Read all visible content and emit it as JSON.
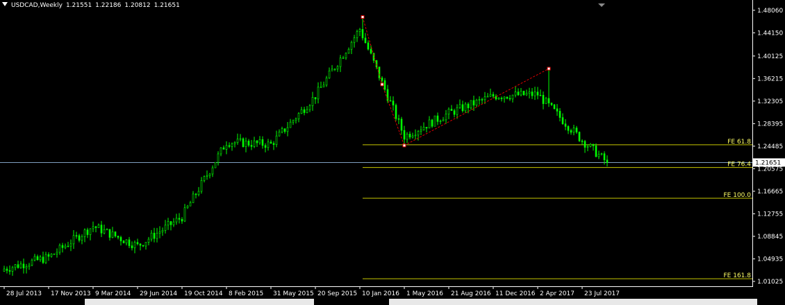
{
  "header": {
    "symbol": "USDCAD,Weekly",
    "open": "1.21551",
    "high": "1.22186",
    "low": "1.20812",
    "close": "1.21651"
  },
  "colors": {
    "background": "#000000",
    "candle": "#00ff00",
    "axis_text": "#ffffff",
    "fibo_line": "#c8c800",
    "fibo_text": "#ffff66",
    "pattern_line": "#dd0000",
    "price_line": "#7f9fc0",
    "price_label_bg": "#ffffff"
  },
  "chart_data": {
    "type": "candlestick",
    "symbol": "USDCAD",
    "timeframe": "Weekly",
    "ylim": [
      1.003,
      1.49
    ],
    "y_ticks": [
      "1.48060",
      "1.44150",
      "1.40125",
      "1.36215",
      "1.32305",
      "1.28395",
      "1.24485",
      "1.20575",
      "1.16665",
      "1.12755",
      "1.08845",
      "1.04935",
      "1.01025"
    ],
    "x_ticks": [
      "28 Jul 2013",
      "17 Nov 2013",
      "9 Mar 2014",
      "29 Jun 2014",
      "19 Oct 2014",
      "8 Feb 2015",
      "31 May 2015",
      "20 Sep 2015",
      "10 Jan 2016",
      "1 May 2016",
      "21 Aug 2016",
      "11 Dec 2016",
      "2 Apr 2017",
      "23 Jul 2017"
    ],
    "close_guide": [
      [
        "28 Jul 2013",
        1.032
      ],
      [
        "17 Nov 2013",
        1.052
      ],
      [
        "9 Mar 2014",
        1.106
      ],
      [
        "29 Jun 2014",
        1.072
      ],
      [
        "19 Oct 2014",
        1.122
      ],
      [
        "8 Feb 2015",
        1.252
      ],
      [
        "31 May 2015",
        1.248
      ],
      [
        "20 Sep 2015",
        1.332
      ],
      [
        "10 Jan 2016",
        1.448
      ],
      [
        "1 May 2016",
        1.262
      ],
      [
        "21 Aug 2016",
        1.302
      ],
      [
        "11 Dec 2016",
        1.332
      ],
      [
        "2 Apr 2017",
        1.335
      ],
      [
        "23 Jul 2017",
        1.255
      ],
      [
        "24 Sep 2017",
        1.2165
      ]
    ],
    "last_price": "1.21651",
    "pattern_points": [
      [
        "17 Jan 2016",
        1.4689
      ],
      [
        "6 Mar 2016",
        1.352
      ],
      [
        "1 May 2016",
        1.2461
      ],
      [
        "30 Apr 2017",
        1.3793
      ]
    ],
    "fibo_levels": [
      {
        "label": "FE 61.8",
        "value": 1.2473
      },
      {
        "label": "FE 76.4",
        "value": 1.2079
      },
      {
        "label": "FE 100.0",
        "value": 1.1545
      },
      {
        "label": "FE 161.8",
        "value": 1.0149
      }
    ]
  }
}
